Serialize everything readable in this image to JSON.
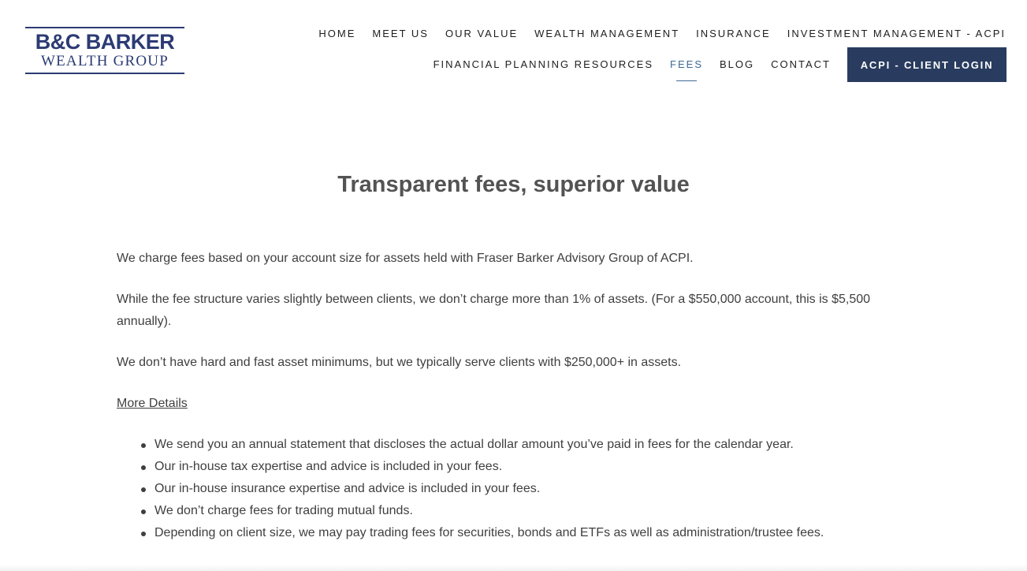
{
  "logo": {
    "line1": "B&C BARKER",
    "line2": "WEALTH GROUP",
    "brand_color": "#2c3b74"
  },
  "nav": {
    "row1": [
      "HOME",
      "MEET US",
      "OUR VALUE",
      "WEALTH MANAGEMENT",
      "INSURANCE",
      "INVESTMENT MANAGEMENT - ACPI"
    ],
    "row2": [
      "FINANCIAL PLANNING RESOURCES",
      "FEES",
      "BLOG",
      "CONTACT"
    ],
    "active_item": "FEES",
    "active_color": "#3e6a93",
    "login_button": "ACPI - CLIENT LOGIN",
    "login_button_color": "#293c5f"
  },
  "main": {
    "title": "Transparent fees, superior value",
    "paragraphs": [
      "We charge fees based on your account size for assets held with Fraser Barker Advisory Group of ACPI.",
      "While the fee structure varies slightly between clients, we don’t charge more than 1% of assets. (For a $550,000 account, this is $5,500 annually).",
      "We don’t have hard and fast asset minimums, but we typically serve clients with $250,000+ in assets."
    ],
    "more_details_link": "More Details",
    "bullets": [
      "We send you an annual statement that discloses the actual dollar amount you’ve paid in fees for the calendar year.",
      "Our in-house tax expertise and advice is included in your fees.",
      "Our in-house insurance expertise and advice is included in your fees.",
      "We don’t charge fees for trading mutual funds.",
      "Depending on client size, we may pay trading fees for securities, bonds and ETFs as well as administration/trustee fees."
    ]
  }
}
